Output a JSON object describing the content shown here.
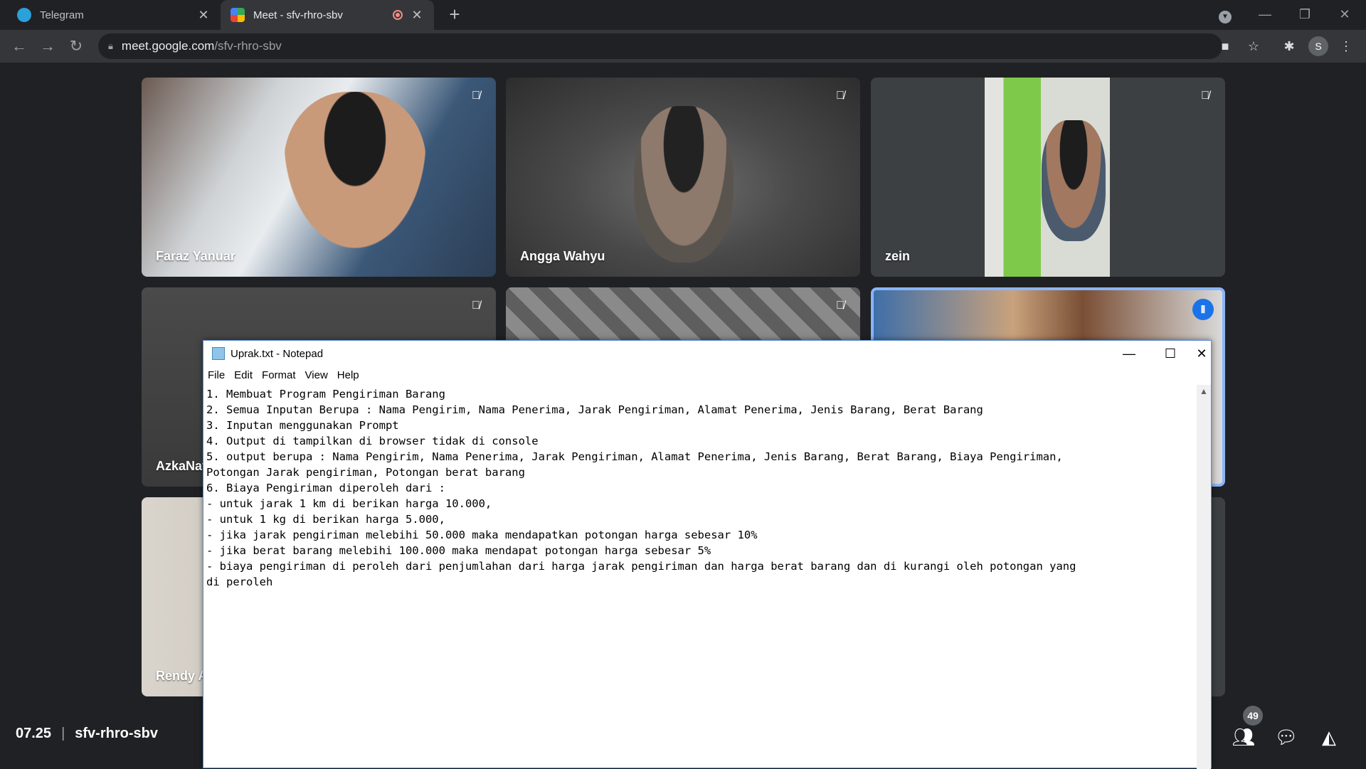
{
  "browser": {
    "tabs": [
      {
        "title": "Telegram",
        "close": "✕"
      },
      {
        "title": "Meet - sfv-rhro-sbv",
        "close": "✕"
      }
    ],
    "url_host": "meet.google.com",
    "url_path": "/sfv-rhro-sbv",
    "profile_initial": "S"
  },
  "participants": [
    {
      "name": "Faraz Yanuar",
      "muted": true
    },
    {
      "name": "Angga Wahyu",
      "muted": true
    },
    {
      "name": "zein",
      "muted": true
    },
    {
      "name": "AzkaNat",
      "muted": true
    },
    {
      "name": "",
      "muted": true
    },
    {
      "name": "",
      "muted": false,
      "speaking": true
    },
    {
      "name": "Rendy A",
      "muted": false
    }
  ],
  "meeting": {
    "time": "07.25",
    "code": "sfv-rhro-sbv",
    "participant_count": "49"
  },
  "notepad": {
    "title": "Uprak.txt - Notepad",
    "menu": [
      "File",
      "Edit",
      "Format",
      "View",
      "Help"
    ],
    "content": "1. Membuat Program Pengiriman Barang\n2. Semua Inputan Berupa : Nama Pengirim, Nama Penerima, Jarak Pengiriman, Alamat Penerima, Jenis Barang, Berat Barang\n3. Inputan menggunakan Prompt\n4. Output di tampilkan di browser tidak di console\n5. output berupa : Nama Pengirim, Nama Penerima, Jarak Pengiriman, Alamat Penerima, Jenis Barang, Berat Barang, Biaya Pengiriman,\nPotongan Jarak pengiriman, Potongan berat barang\n6. Biaya Pengiriman diperoleh dari :\n- untuk jarak 1 km di berikan harga 10.000,\n- untuk 1 kg di berikan harga 5.000,\n- jika jarak pengiriman melebihi 50.000 maka mendapatkan potongan harga sebesar 10%\n- jika berat barang melebihi 100.000 maka mendapat potongan harga sebesar 5%\n- biaya pengiriman di peroleh dari penjumlahan dari harga jarak pengiriman dan harga berat barang dan di kurangi oleh potongan yang\ndi peroleh"
  }
}
